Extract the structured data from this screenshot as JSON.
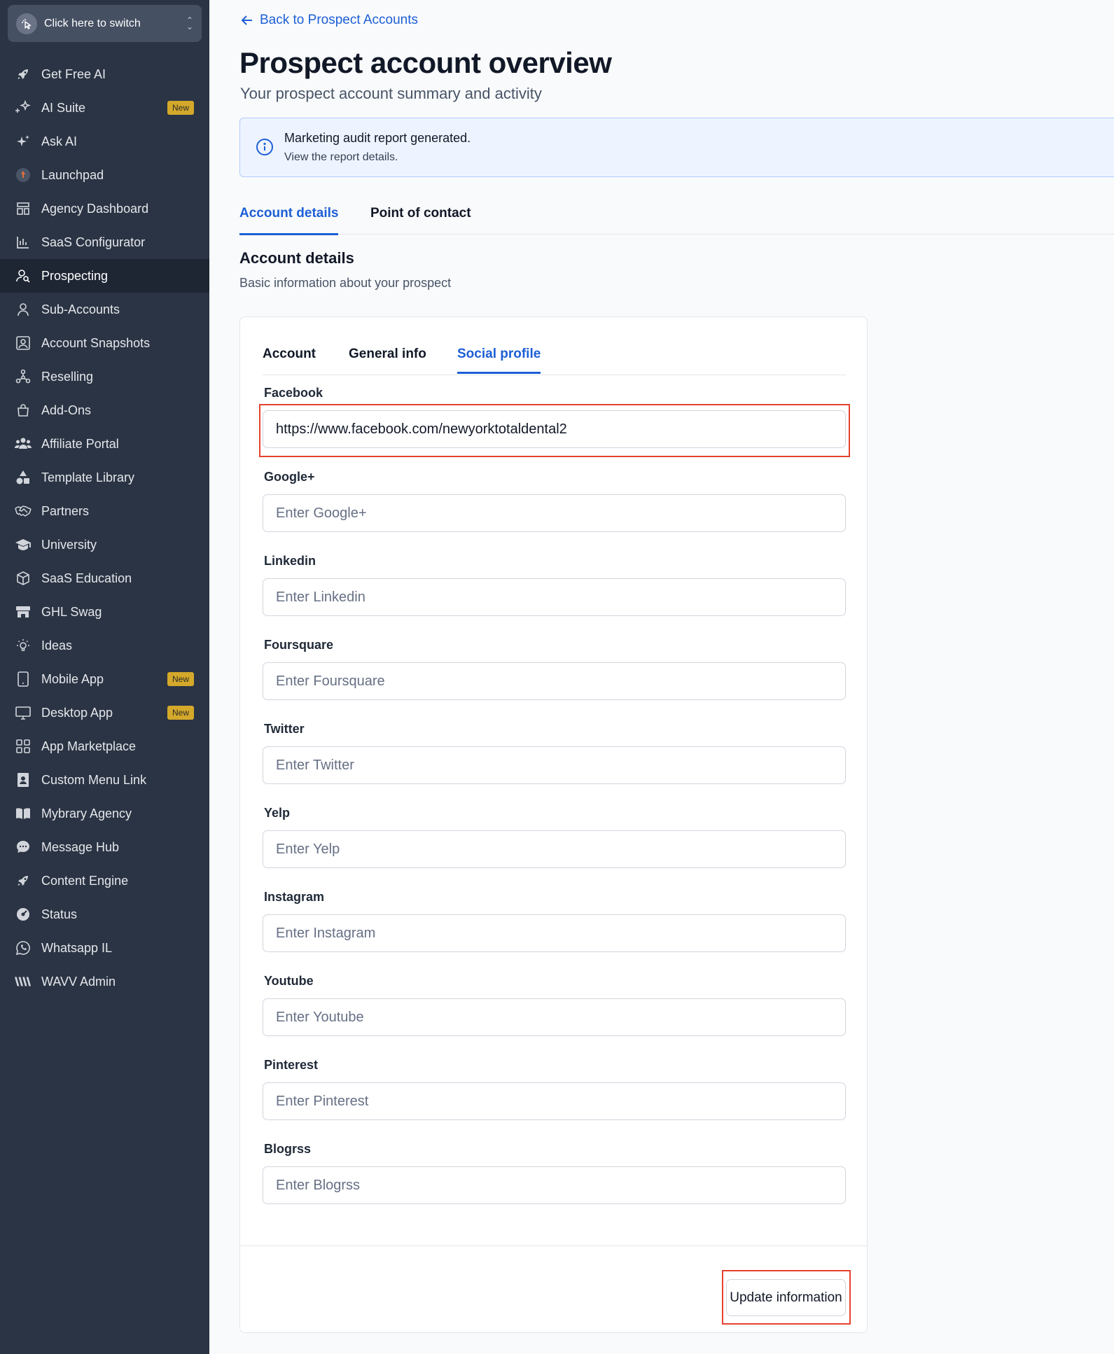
{
  "switcher": {
    "label": "Click here to switch"
  },
  "sidebar": {
    "items": [
      {
        "label": "Get Free AI",
        "icon": "rocket-icon"
      },
      {
        "label": "AI Suite",
        "icon": "sparkles-icon",
        "badge": "New"
      },
      {
        "label": "Ask AI",
        "icon": "ai-sparkle-icon"
      },
      {
        "label": "Launchpad",
        "icon": "launchpad-icon"
      },
      {
        "label": "Agency Dashboard",
        "icon": "dashboard-icon"
      },
      {
        "label": "SaaS Configurator",
        "icon": "bar-chart-icon"
      },
      {
        "label": "Prospecting",
        "icon": "user-search-icon",
        "active": true
      },
      {
        "label": "Sub-Accounts",
        "icon": "user-icon"
      },
      {
        "label": "Account Snapshots",
        "icon": "snapshot-icon"
      },
      {
        "label": "Reselling",
        "icon": "network-icon"
      },
      {
        "label": "Add-Ons",
        "icon": "shopping-bag-icon"
      },
      {
        "label": "Affiliate Portal",
        "icon": "users-icon"
      },
      {
        "label": "Template Library",
        "icon": "shapes-icon"
      },
      {
        "label": "Partners",
        "icon": "handshake-icon"
      },
      {
        "label": "University",
        "icon": "graduation-cap-icon"
      },
      {
        "label": "SaaS Education",
        "icon": "cube-icon"
      },
      {
        "label": "GHL Swag",
        "icon": "store-icon"
      },
      {
        "label": "Ideas",
        "icon": "lightbulb-icon"
      },
      {
        "label": "Mobile App",
        "icon": "mobile-icon",
        "badge": "New"
      },
      {
        "label": "Desktop App",
        "icon": "desktop-icon",
        "badge": "New"
      },
      {
        "label": "App Marketplace",
        "icon": "grid-icon"
      },
      {
        "label": "Custom Menu Link",
        "icon": "contact-card-icon"
      },
      {
        "label": "Mybrary Agency",
        "icon": "book-icon"
      },
      {
        "label": "Message Hub",
        "icon": "chat-bubble-icon"
      },
      {
        "label": "Content Engine",
        "icon": "rocket-icon"
      },
      {
        "label": "Status",
        "icon": "status-icon"
      },
      {
        "label": "Whatsapp IL",
        "icon": "whatsapp-icon"
      },
      {
        "label": "WAVV Admin",
        "icon": "wavv-icon"
      }
    ]
  },
  "main": {
    "back_label": "Back to Prospect Accounts",
    "title": "Prospect account overview",
    "subtitle": "Your prospect account summary and activity",
    "alert": {
      "title": "Marketing audit report generated.",
      "text": "View the report details."
    },
    "tabs": [
      {
        "label": "Account details",
        "active": true
      },
      {
        "label": "Point of contact"
      }
    ],
    "section": {
      "title": "Account details",
      "subtitle": "Basic information about your prospect"
    },
    "inner_tabs": [
      {
        "label": "Account"
      },
      {
        "label": "General info"
      },
      {
        "label": "Social profile",
        "active": true
      }
    ],
    "fields": [
      {
        "label": "Facebook",
        "value": "https://www.facebook.com/newyorktotaldental2",
        "placeholder": ""
      },
      {
        "label": "Google+",
        "value": "",
        "placeholder": "Enter Google+"
      },
      {
        "label": "Linkedin",
        "value": "",
        "placeholder": "Enter Linkedin"
      },
      {
        "label": "Foursquare",
        "value": "",
        "placeholder": "Enter Foursquare"
      },
      {
        "label": "Twitter",
        "value": "",
        "placeholder": "Enter Twitter"
      },
      {
        "label": "Yelp",
        "value": "",
        "placeholder": "Enter Yelp"
      },
      {
        "label": "Instagram",
        "value": "",
        "placeholder": "Enter Instagram"
      },
      {
        "label": "Youtube",
        "value": "",
        "placeholder": "Enter Youtube"
      },
      {
        "label": "Pinterest",
        "value": "",
        "placeholder": "Enter Pinterest"
      },
      {
        "label": "Blogrss",
        "value": "",
        "placeholder": "Enter Blogrss"
      }
    ],
    "update_button": "Update information"
  },
  "colors": {
    "sidebar_bg": "#2b3444",
    "accent": "#1d5fd6",
    "badge": "#d4a82a",
    "highlight": "#e5422e"
  }
}
